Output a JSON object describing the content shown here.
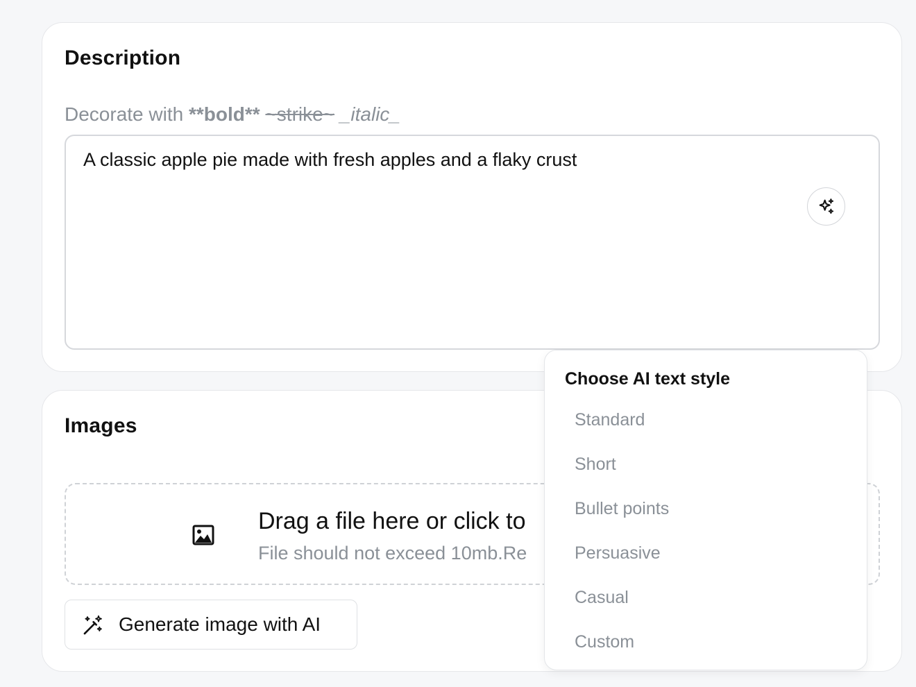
{
  "description": {
    "title": "Description",
    "hint_prefix": "Decorate with",
    "hint_bold": "**bold**",
    "hint_strike": "~strike~",
    "hint_italic": "_italic_",
    "text_value": "A classic apple pie made with fresh apples and a flaky crust",
    "ai_button_icon": "sparkles-icon"
  },
  "images": {
    "title": "Images",
    "dropzone_icon": "image-icon",
    "dropzone_title": "Drag a file here or click to",
    "dropzone_subtitle": "File should not exceed 10mb.Re",
    "generate_label": "Generate image with AI",
    "generate_icon": "magic-wand-icon"
  },
  "ai_style_menu": {
    "title": "Choose AI text style",
    "items": [
      "Standard",
      "Short",
      "Bullet points",
      "Persuasive",
      "Casual",
      "Custom"
    ]
  }
}
